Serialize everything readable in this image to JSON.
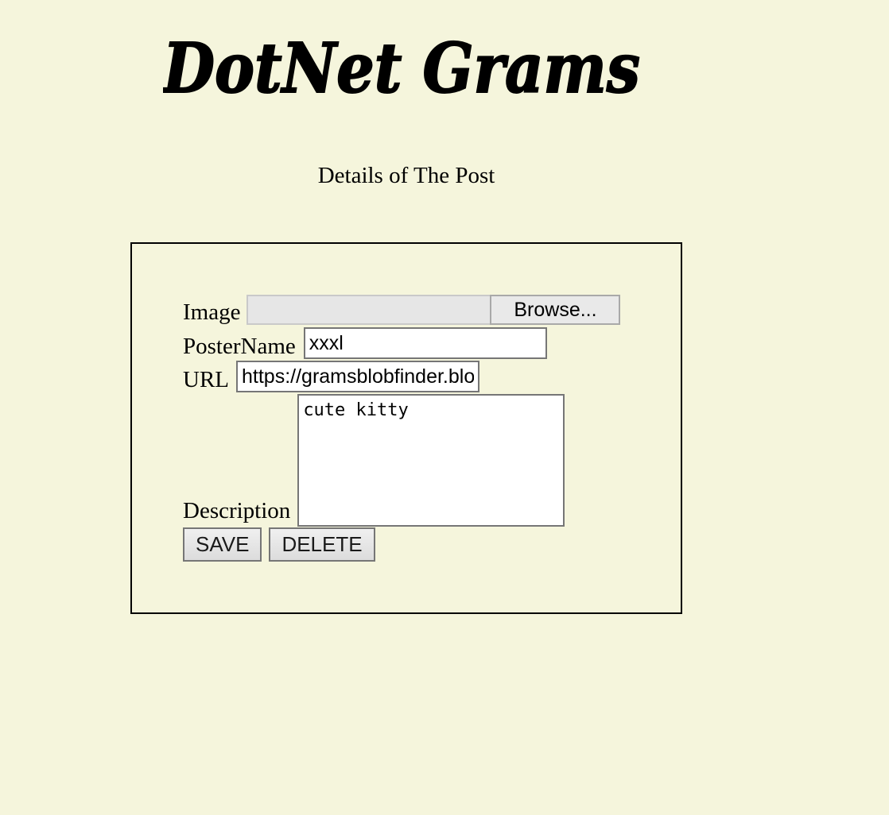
{
  "header": {
    "brand": "DotNet Grams"
  },
  "page": {
    "title": "Details of The Post"
  },
  "form": {
    "image_label": "Image",
    "browse_label": "Browse...",
    "poster_label": "PosterName",
    "poster_value": "xxxl",
    "url_label": "URL",
    "url_value": "https://gramsblobfinder.blob.core.windows.net",
    "description_label": "Description",
    "description_value": "cute kitty",
    "save_label": "SAVE",
    "delete_label": "DELETE"
  }
}
